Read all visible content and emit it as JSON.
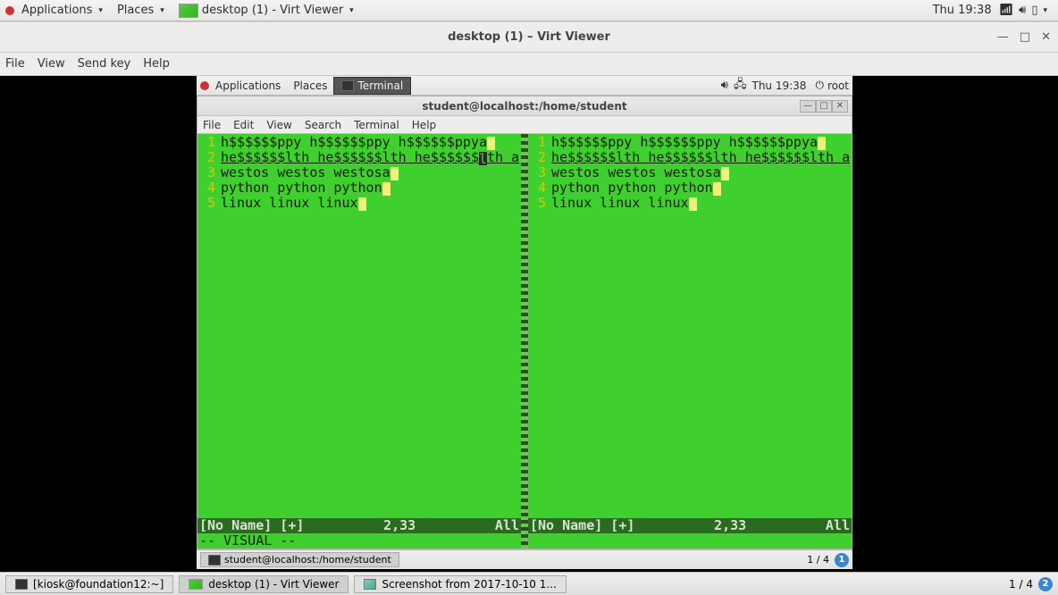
{
  "outer_panel": {
    "applications": "Applications",
    "places": "Places",
    "active_window": "desktop (1) - Virt Viewer",
    "clock": "Thu 19:38"
  },
  "virt_viewer": {
    "title": "desktop (1) – Virt Viewer",
    "menu": {
      "file": "File",
      "view": "View",
      "sendkey": "Send key",
      "help": "Help"
    }
  },
  "guest_panel": {
    "applications": "Applications",
    "places": "Places",
    "active_task": "Terminal",
    "clock": "Thu 19:38",
    "user": "root"
  },
  "terminal": {
    "title": "student@localhost:/home/student",
    "menu": {
      "file": "File",
      "edit": "Edit",
      "view": "View",
      "search": "Search",
      "terminal": "Terminal",
      "help": "Help"
    },
    "lines": [
      "h$$$$$$ppy h$$$$$$ppy h$$$$$$ppya",
      "he$$$$$$lth he$$$$$$lth he$$$$$$lth a",
      "westos westos westosa",
      "python python python",
      "linux linux linux"
    ],
    "status_left": {
      "name": "[No Name] [+]",
      "pos": "2,33",
      "pct": "All"
    },
    "status_right": {
      "name": "[No Name] [+]",
      "pos": "2,33",
      "pct": "All"
    },
    "mode": "-- VISUAL --"
  },
  "guest_taskbar": {
    "task": "student@localhost:/home/student",
    "ws_label": "1 / 4",
    "ws_current": "1"
  },
  "host_taskbar": {
    "task1": "[kiosk@foundation12:~]",
    "task2": "desktop (1) - Virt Viewer",
    "task3": "Screenshot from 2017-10-10 1...",
    "ws_label": "1 / 4",
    "ws_current": "2"
  }
}
